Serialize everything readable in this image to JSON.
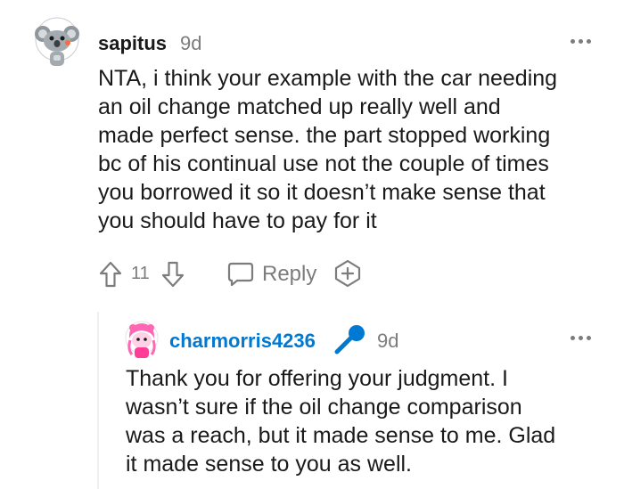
{
  "comment": {
    "username": "sapitus",
    "time": "9d",
    "lines": [
      "NTA, i think your example with the car needing",
      "an oil change matched up really well and",
      "made perfect sense. the part stopped working",
      "bc of his continual use not the couple of times",
      "you borrowed it so it doesn’t make sense that",
      "you should have to pay for it"
    ],
    "votes": "11",
    "reply_label": "Reply"
  },
  "reply": {
    "username": "charmorris4236",
    "time": "9d",
    "lines": [
      "Thank you for offering your judgment. I",
      "wasn’t sure if the oil change comparison",
      "was a reach, but it made sense to me. Glad",
      "it made sense to you as well."
    ]
  },
  "colors": {
    "reply_username": "#0079d3",
    "mic_badge": "#0079d3",
    "muted": "#7c7c7c",
    "text": "#1a1a1b"
  },
  "icons": {
    "avatar1": "snoo-avatar-icon",
    "avatar2": "pink-snoo-avatar-icon",
    "upvote": "upvote-arrow-icon",
    "downvote": "downvote-arrow-icon",
    "reply": "chat-bubble-icon",
    "award": "award-plus-icon",
    "more": "more-dots-icon",
    "mic": "microphone-icon"
  }
}
